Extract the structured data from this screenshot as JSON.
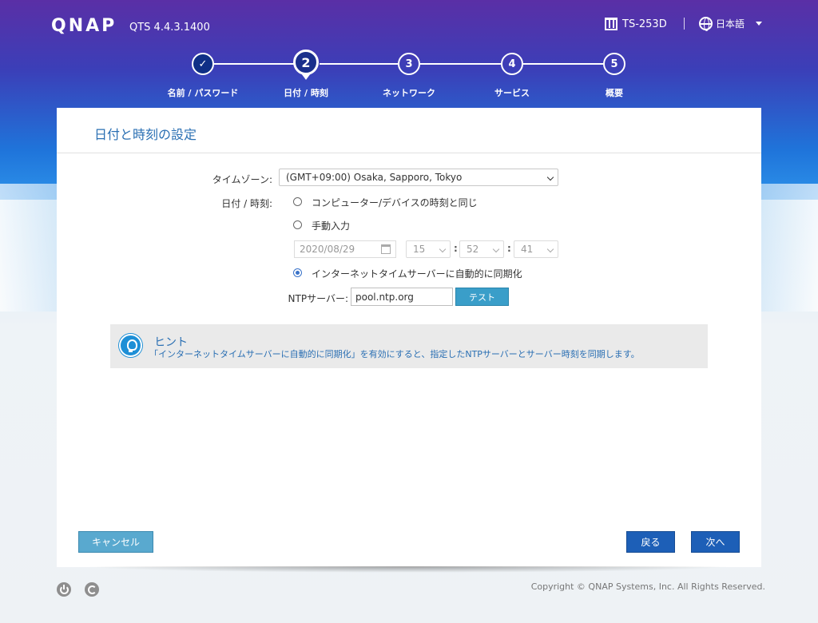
{
  "header": {
    "logo": "QNAP",
    "version": "QTS 4.4.3.1400",
    "device_name": "TS-253D",
    "language": "日本語"
  },
  "steps": [
    {
      "num": "✓",
      "label": "名前 / パスワード",
      "state": "done"
    },
    {
      "num": "2",
      "label": "日付 / 時刻",
      "state": "current"
    },
    {
      "num": "3",
      "label": "ネットワーク",
      "state": "pending"
    },
    {
      "num": "4",
      "label": "サービス",
      "state": "pending"
    },
    {
      "num": "5",
      "label": "概要",
      "state": "pending"
    }
  ],
  "panel": {
    "title": "日付と時刻の設定",
    "timezone_label": "タイムゾーン:",
    "timezone_value": "(GMT+09:00) Osaka, Sapporo, Tokyo",
    "datetime_label": "日付 / 時刻:",
    "options": {
      "same_as_pc": "コンピューター/デバイスの時刻と同じ",
      "manual": "手動入力",
      "ntp_sync": "インターネットタイムサーバーに自動的に同期化"
    },
    "selected_option": "ntp_sync",
    "manual_date": "2020/08/29",
    "manual_hour": "15",
    "manual_minute": "52",
    "manual_second": "41",
    "ntp_label": "NTPサーバー:",
    "ntp_value": "pool.ntp.org",
    "test_button": "テスト"
  },
  "hint": {
    "title": "ヒント",
    "text": "「インターネットタイムサーバーに自動的に同期化」を有効にすると、指定したNTPサーバーとサーバー時刻を同期します。"
  },
  "buttons": {
    "cancel": "キャンセル",
    "back": "戻る",
    "next": "次へ"
  },
  "footer": {
    "copyright": "Copyright © QNAP Systems, Inc. All Rights Reserved."
  },
  "colors": {
    "accent": "#1d5fb7",
    "title_blue": "#2a6fb3",
    "test_button": "#3a9ec9",
    "cancel_button": "#59a9cf"
  }
}
